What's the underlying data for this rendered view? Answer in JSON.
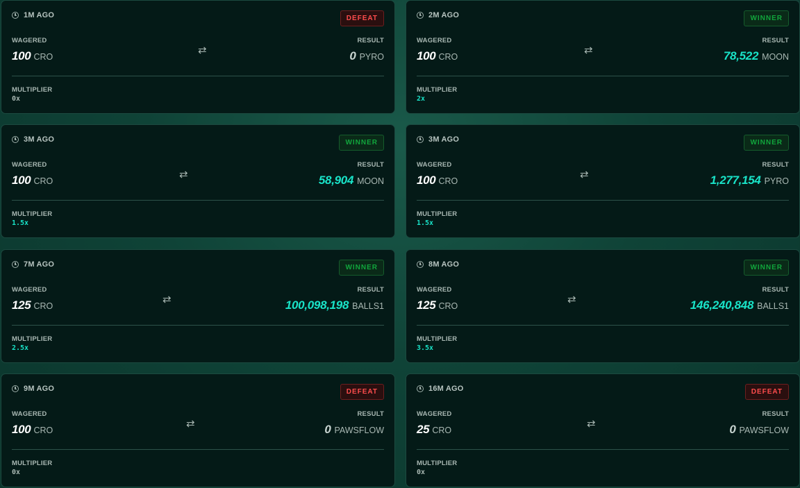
{
  "labels": {
    "wagered": "WAGERED",
    "result": "RESULT",
    "multiplier": "MULTIPLIER",
    "swap_icon": "swap-arrows-icon",
    "clock_icon": "clock-icon"
  },
  "colors": {
    "win_accent": "#19e3c8",
    "defeat_red": "#ff4d4d",
    "winner_green": "#11a63c",
    "card_bg": "#041a17"
  },
  "cards": [
    {
      "time": "1M AGO",
      "badge": "DEFEAT",
      "status": "defeat",
      "wager_amount": "100",
      "wager_currency": "CRO",
      "result_amount": "0",
      "result_currency": "PYRO",
      "multiplier": "0x"
    },
    {
      "time": "2M AGO",
      "badge": "WINNER",
      "status": "winner",
      "wager_amount": "100",
      "wager_currency": "CRO",
      "result_amount": "78,522",
      "result_currency": "MOON",
      "multiplier": "2x"
    },
    {
      "time": "3M AGO",
      "badge": "WINNER",
      "status": "winner",
      "wager_amount": "100",
      "wager_currency": "CRO",
      "result_amount": "58,904",
      "result_currency": "MOON",
      "multiplier": "1.5x"
    },
    {
      "time": "3M AGO",
      "badge": "WINNER",
      "status": "winner",
      "wager_amount": "100",
      "wager_currency": "CRO",
      "result_amount": "1,277,154",
      "result_currency": "PYRO",
      "multiplier": "1.5x"
    },
    {
      "time": "7M AGO",
      "badge": "WINNER",
      "status": "winner",
      "wager_amount": "125",
      "wager_currency": "CRO",
      "result_amount": "100,098,198",
      "result_currency": "BALLS1",
      "multiplier": "2.5x"
    },
    {
      "time": "8M AGO",
      "badge": "WINNER",
      "status": "winner",
      "wager_amount": "125",
      "wager_currency": "CRO",
      "result_amount": "146,240,848",
      "result_currency": "BALLS1",
      "multiplier": "3.5x"
    },
    {
      "time": "9M AGO",
      "badge": "DEFEAT",
      "status": "defeat",
      "wager_amount": "100",
      "wager_currency": "CRO",
      "result_amount": "0",
      "result_currency": "PAWSFLOW",
      "multiplier": "0x"
    },
    {
      "time": "16M AGO",
      "badge": "DEFEAT",
      "status": "defeat",
      "wager_amount": "25",
      "wager_currency": "CRO",
      "result_amount": "0",
      "result_currency": "PAWSFLOW",
      "multiplier": "0x"
    }
  ]
}
